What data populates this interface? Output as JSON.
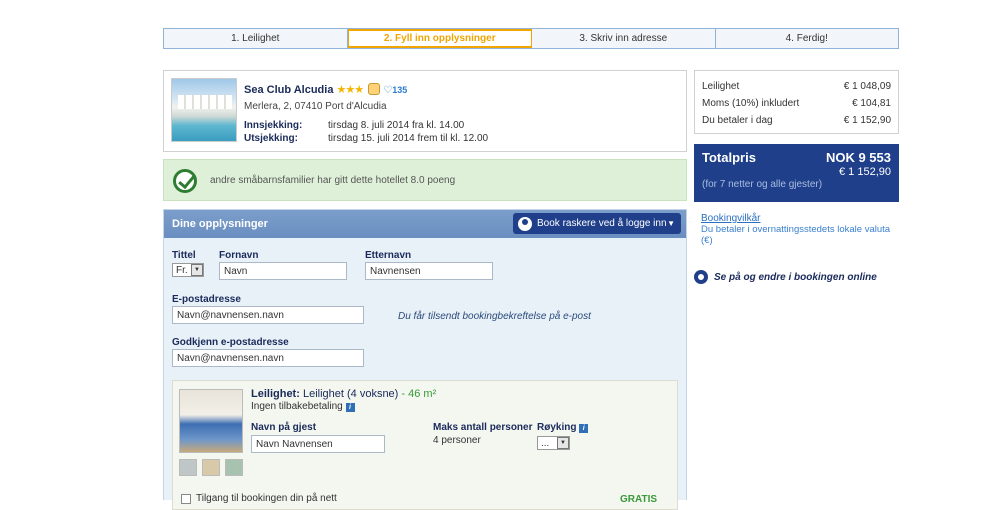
{
  "steps": [
    "1. Leilighet",
    "2. Fyll inn opplysninger",
    "3. Skriv inn adresse",
    "4. Ferdig!"
  ],
  "hotel": {
    "name": "Sea Club Alcudia",
    "stars": "★★★",
    "likes": "135",
    "address": "Merlera, 2, 07410 Port d'Alcudia",
    "checkin_label": "Innsjekking:",
    "checkin_value": "tirsdag 8. juli 2014 fra kl. 14.00",
    "checkout_label": "Utsjekking:",
    "checkout_value": "tirsdag 15. juli 2014 frem til kl. 12.00"
  },
  "rating_text": "andre småbarnsfamilier har gitt dette hotellet 8.0 poeng",
  "details": {
    "header": "Dine opplysninger",
    "login_button": "Book raskere ved å logge inn",
    "title_label": "Tittel",
    "title_value": "Fr.",
    "firstname_label": "Fornavn",
    "firstname_value": "Navn",
    "lastname_label": "Etternavn",
    "lastname_value": "Navnensen",
    "email_label": "E-postadresse",
    "email_value": "Navn@navnensen.navn",
    "email_hint": "Du får tilsendt bookingbekreftelse på e-post",
    "confirm_label": "Godkjenn e-postadresse",
    "confirm_value": "Navn@navnensen.navn"
  },
  "room": {
    "title_bold": "Leilighet:",
    "title_rest": "Leilighet (4 voksne)",
    "size": "- 46 m²",
    "refund": "Ingen tilbakebetaling",
    "guest_label": "Navn på gjest",
    "guest_value": "Navn Navnensen",
    "max_label": "Maks antall personer",
    "max_value": "4 personer",
    "smoking_label": "Røyking",
    "smoking_value": "..."
  },
  "access_label": "Tilgang til bookingen din på nett",
  "gratis": "GRATIS",
  "summary": {
    "rows": [
      {
        "label": "Leilighet",
        "value": "€ 1 048,09"
      },
      {
        "label": "Moms (10%) inkludert",
        "value": "€ 104,81"
      },
      {
        "label": "Du betaler i dag",
        "value": "€ 1 152,90"
      }
    ],
    "total_label": "Totalpris",
    "total_nok": "NOK 9 553",
    "total_eur": "€ 1 152,90",
    "total_note": "(for 7 netter og alle gjester)"
  },
  "terms_link": "Bookingvilkår",
  "terms_note": "Du betaler i overnattingsstedets lokale valuta (€)",
  "manage_link": "Se på og endre i bookingen online"
}
